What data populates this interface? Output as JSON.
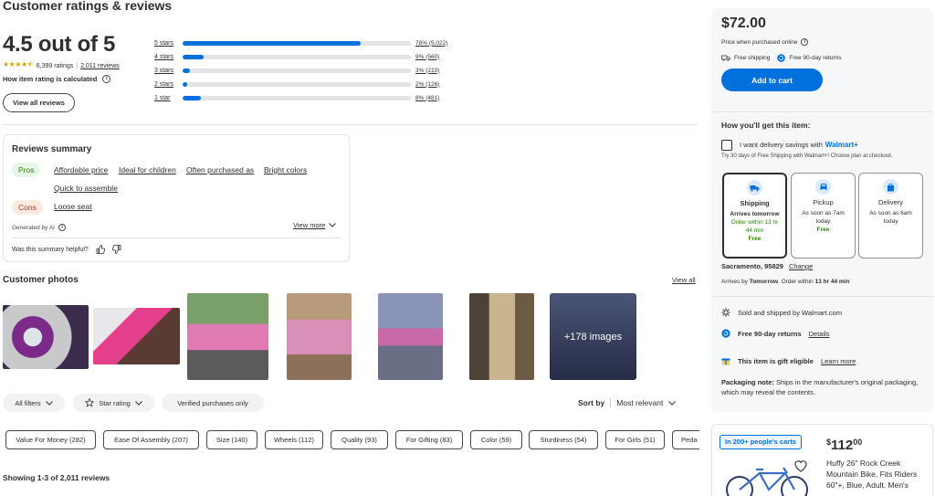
{
  "ratings": {
    "heading": "Customer ratings & reviews",
    "overall": "4.5 out of 5",
    "stars_value": 4.5,
    "ratings_count": "6,399 ratings",
    "reviews_link": "2,011 reviews",
    "how_calculated": "How item rating is calculated",
    "view_all_button": "View all reviews",
    "bars": [
      {
        "label": "5 stars",
        "pct": 78,
        "count": "78% (5,022)"
      },
      {
        "label": "4 stars",
        "pct": 9,
        "count": "9% (560)"
      },
      {
        "label": "3 stars",
        "pct": 3,
        "count": "3% (210)"
      },
      {
        "label": "2 stars",
        "pct": 2,
        "count": "2% (126)"
      },
      {
        "label": "1 star",
        "pct": 8,
        "count": "8% (481)"
      }
    ]
  },
  "summary": {
    "title": "Reviews summary",
    "pros_label": "Pros",
    "pros": [
      "Affordable price",
      "Ideal for children",
      "Often purchased as",
      "Bright colors",
      "Quick to assemble"
    ],
    "cons_label": "Cons",
    "cons": [
      "Loose seat"
    ],
    "generated": "Generated by AI",
    "view_more": "View more",
    "helpful": "Was this summary helpful?"
  },
  "photos": {
    "title": "Customer photos",
    "view_all": "View all",
    "more_label": "+178 images"
  },
  "filters": {
    "all_filters": "All filters",
    "star_rating": "Star rating",
    "verified": "Verified purchases only",
    "sort_label": "Sort by",
    "sort_value": "Most relevant",
    "chips": [
      "Value For Money (282)",
      "Ease Of Assembly (207)",
      "Size (140)",
      "Wheels (112)",
      "Quality (93)",
      "For Gifting (83)",
      "Color (59)",
      "Sturdiness (54)",
      "For Girls (51)",
      "Peda"
    ]
  },
  "showing": "Showing 1-3 of 2,011 reviews",
  "buybox": {
    "price": "$72.00",
    "price_note": "Price when purchased online",
    "free_shipping": "Free shipping",
    "free_returns": "Free 90-day returns",
    "add_to_cart": "Add to cart",
    "how_title": "How you'll get this item:",
    "delivery_savings": "I want delivery savings with",
    "walmart_plus": "Walmart+",
    "trial_note": "Try 30 days of Free Shipping with Walmart+! Choose plan at checkout.",
    "options": [
      {
        "title": "Shipping",
        "l1": "Arrives tomorrow",
        "l2": "Order within 13 hr",
        "l3": "44 min",
        "l4": "Free"
      },
      {
        "title": "Pickup",
        "l1": "As soon as 7am",
        "l2": "today",
        "l3": "Free",
        "l4": ""
      },
      {
        "title": "Delivery",
        "l1": "As soon as 6am",
        "l2": "today",
        "l3": "",
        "l4": ""
      }
    ],
    "location": "Sacramento, 95829",
    "change": "Change",
    "arrives_prefix": "Arrives by",
    "arrives_day": "Tomorrow",
    "arrives_mid": ". Order within",
    "arrives_time": "13 hr 44 min",
    "sold_by": "Sold and shipped by Walmart.com",
    "returns_label": "Free 90-day returns",
    "returns_link": "Details",
    "gift_label": "This item is gift eligible",
    "gift_link": "Learn more",
    "packaging_label": "Packaging note:",
    "packaging_text": "Ships in the manufacturer's original packaging, which may reveal the contents."
  },
  "ad": {
    "badge": "In 200+ people's carts",
    "price_currency": "$",
    "price_whole": "112",
    "price_cents": "00",
    "title": "Huffy 26\" Rock Creek Mountain Bike, Fits Riders 60\"+, Blue, Adult, Men's"
  },
  "colors": {
    "accent": "#0071dc",
    "star": "#d4a106",
    "green": "#2a8703",
    "pros_bg": "#e8f5e9",
    "cons_bg": "#fdeadf"
  }
}
